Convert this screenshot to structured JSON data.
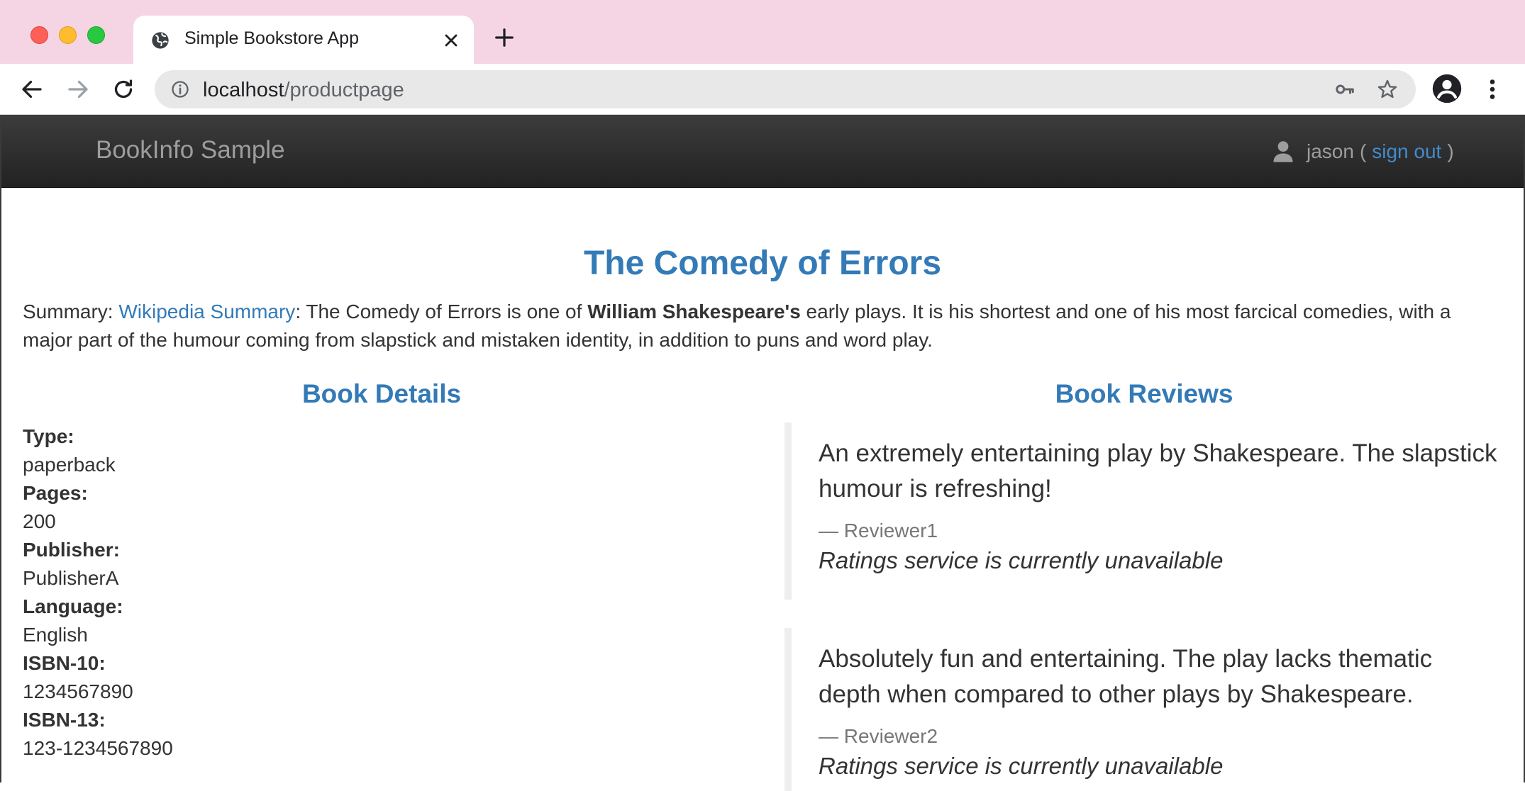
{
  "browser": {
    "tab_title": "Simple Bookstore App",
    "url_host": "localhost",
    "url_path": "/productpage"
  },
  "navbar": {
    "brand": "BookInfo Sample",
    "user": "jason",
    "paren_open": "(",
    "signout_label": "sign out",
    "paren_close": ")"
  },
  "product": {
    "title": "The Comedy of Errors",
    "summary_label": "Summary:",
    "summary_link": "Wikipedia Summary",
    "summary_part1": ": The Comedy of Errors is one of",
    "summary_bold": "William Shakespeare's",
    "summary_part2": "early plays. It is his shortest and one of his most farcical comedies, with a major part of the humour coming from slapstick and mistaken identity, in addition to puns and word play."
  },
  "details": {
    "heading": "Book Details",
    "fields": [
      {
        "label": "Type:",
        "value": "paperback"
      },
      {
        "label": "Pages:",
        "value": "200"
      },
      {
        "label": "Publisher:",
        "value": "PublisherA"
      },
      {
        "label": "Language:",
        "value": "English"
      },
      {
        "label": "ISBN-10:",
        "value": "1234567890"
      },
      {
        "label": "ISBN-13:",
        "value": "123-1234567890"
      }
    ]
  },
  "reviews": {
    "heading": "Book Reviews",
    "items": [
      {
        "text": "An extremely entertaining play by Shakespeare. The slapstick humour is refreshing!",
        "reviewer": "— Reviewer1",
        "ratings": "Ratings service is currently unavailable"
      },
      {
        "text": "Absolutely fun and entertaining. The play lacks thematic depth when compared to other plays by Shakespeare.",
        "reviewer": "— Reviewer2",
        "ratings": "Ratings service is currently unavailable"
      }
    ]
  },
  "icons": {
    "tab": "globe-icon",
    "close": "close-icon",
    "new_tab": "plus-icon",
    "back": "back-arrow-icon",
    "forward": "forward-arrow-icon",
    "reload": "reload-icon",
    "site_info": "info-icon",
    "password": "key-icon",
    "bookmark": "star-icon",
    "profile": "profile-icon",
    "menu": "more-vert-icon",
    "user": "user-icon"
  },
  "colors": {
    "tabstrip": "#f5d5e3",
    "link": "#337ab7",
    "navbar": "#222222"
  }
}
